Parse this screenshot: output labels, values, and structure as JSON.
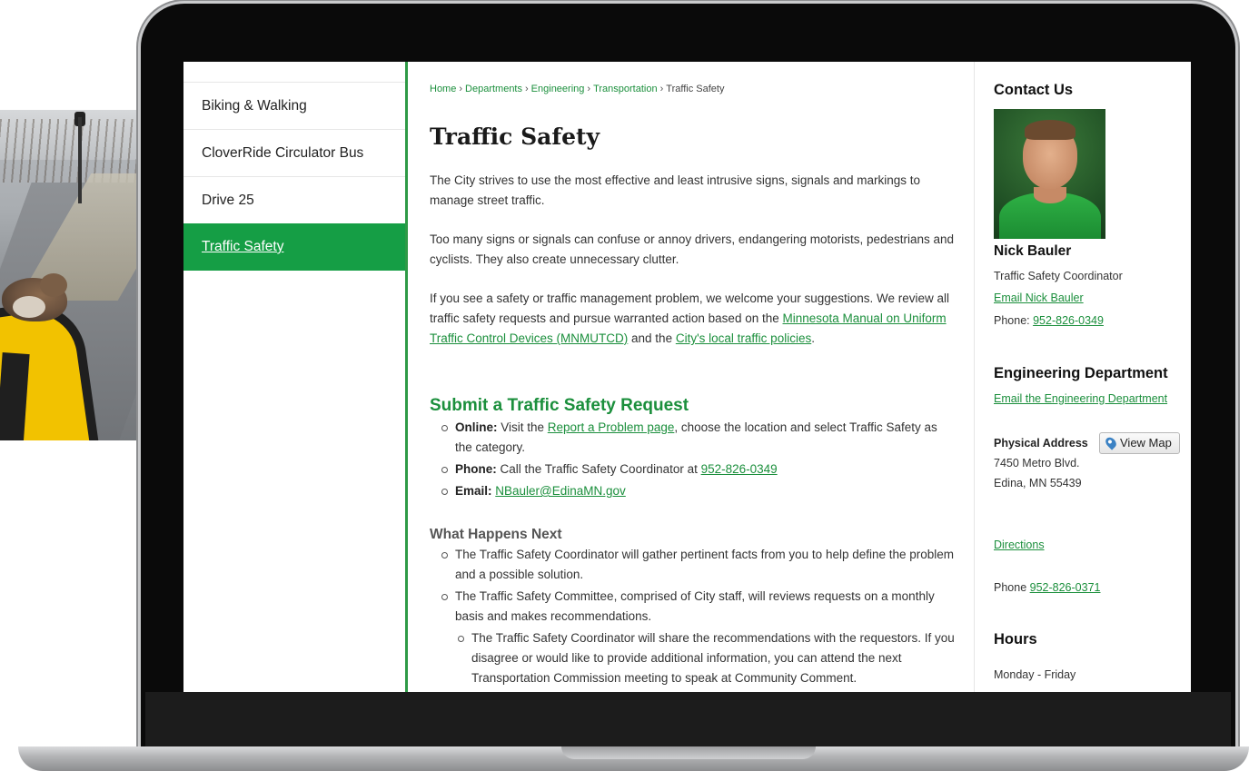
{
  "nav": {
    "items": [
      {
        "label": "Biking & Walking",
        "active": false
      },
      {
        "label": "CloverRide Circulator Bus",
        "active": false
      },
      {
        "label": "Drive 25",
        "active": false
      },
      {
        "label": "Traffic Safety",
        "active": true
      }
    ]
  },
  "breadcrumb": {
    "items": [
      "Home",
      "Departments",
      "Engineering",
      "Transportation",
      "Traffic Safety"
    ],
    "separator": "›"
  },
  "page": {
    "title": "Traffic Safety",
    "intro1": "The City strives to use the most effective and least intrusive signs, signals and markings to manage street traffic.",
    "intro2": "Too many signs or signals can confuse or annoy drivers, endangering motorists, pedestrians and cyclists. They also create unnecessary clutter.",
    "intro3_a": "If you see a safety or traffic management problem, we welcome your suggestions. We review all traffic safety requests and pursue warranted action based on the ",
    "intro3_link1": "Minnesota Manual on Uniform Traffic Control Devices (MNMUTCD)",
    "intro3_b": " and the ",
    "intro3_link2": "City's local traffic policies",
    "intro3_c": "."
  },
  "submit": {
    "heading": "Submit a Traffic Safety Request",
    "online_label": "Online:",
    "online_a": " Visit the ",
    "online_link": "Report a Problem page",
    "online_b": ", choose the location and select Traffic Safety as the category.",
    "phone_label": "Phone:",
    "phone_text": " Call the Traffic Safety Coordinator at ",
    "phone_link": "952-826-0349",
    "email_label": "Email:",
    "email_link": "NBauler@EdinaMN.gov"
  },
  "next": {
    "heading": "What Happens Next",
    "item1": "The Traffic Safety Coordinator will gather pertinent facts from you to help define the problem and a possible solution.",
    "item2": "The Traffic Safety Committee, comprised of City staff, will reviews requests on a monthly basis and makes recommendations.",
    "item3": "The Traffic Safety Coordinator will share the recommendations with the requestors. If you disagree or would like to provide additional information, you can attend the next Transportation Commission meeting to speak at Community Comment."
  },
  "contact": {
    "heading": "Contact Us",
    "name": "Nick Bauler",
    "role": "Traffic Safety Coordinator",
    "email_link": "Email Nick Bauler",
    "phone_label": "Phone: ",
    "phone_link": "952-826-0349",
    "dept_heading": "Engineering Department",
    "dept_email_link": "Email the Engineering Department",
    "address_label": "Physical Address",
    "map_button": "View Map",
    "address_line1": "7450 Metro Blvd.",
    "address_line2": "Edina, MN 55439",
    "directions_link": "Directions",
    "dept_phone_label": "Phone ",
    "dept_phone_link": "952-826-0371",
    "hours_heading": "Hours",
    "hours_text": "Monday - Friday"
  },
  "colors": {
    "accent": "#159e45",
    "link": "#1b8f3c",
    "bezel": "#0a0a0a"
  }
}
